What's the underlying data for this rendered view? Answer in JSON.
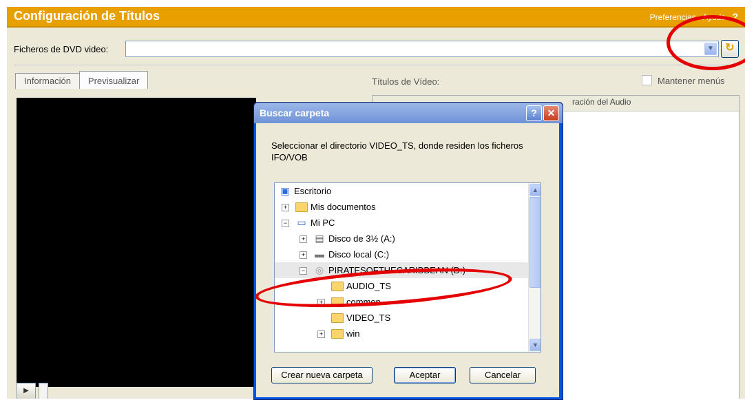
{
  "app": {
    "title": "Configuración de Títulos",
    "menu_preferences": "Preferencias",
    "menu_help": "Ayuda",
    "help_symbol": "?"
  },
  "source": {
    "label": "Ficheros de DVD video:",
    "value": ""
  },
  "tabs": [
    {
      "label": "Información"
    },
    {
      "label": "Previsualizar"
    }
  ],
  "titles_panel": {
    "label": "Títulos de Vídeo:",
    "keep_menus_label": "Mantener menús",
    "keep_menus_checked": false,
    "visible_column": "ración del Audio"
  },
  "dialog": {
    "title": "Buscar carpeta",
    "message": "Seleccionar el directorio VIDEO_TS, donde residen los ficheros IFO/VOB",
    "tree": [
      {
        "label": "Escritorio",
        "icon": "desktop-icon"
      },
      {
        "label": "Mis documentos",
        "icon": "folder-icon"
      },
      {
        "label": "Mi PC",
        "icon": "computer-icon"
      },
      {
        "label": "Disco de 3½ (A:)",
        "icon": "floppy-icon"
      },
      {
        "label": "Disco local (C:)",
        "icon": "harddisk-icon"
      },
      {
        "label": "PIRATESOFTHECARIBBEAN (D:)",
        "icon": "dvd-icon"
      },
      {
        "label": "AUDIO_TS",
        "icon": "folder-icon"
      },
      {
        "label": "common",
        "icon": "folder-icon"
      },
      {
        "label": "VIDEO_TS",
        "icon": "folder-icon"
      },
      {
        "label": "win",
        "icon": "folder-icon"
      }
    ],
    "new_folder_button": "Crear nueva carpeta",
    "ok_button": "Aceptar",
    "cancel_button": "Cancelar"
  },
  "colors": {
    "header": "#e8a000",
    "annotation": "#e40000",
    "dialog_title": "#0055e5"
  }
}
